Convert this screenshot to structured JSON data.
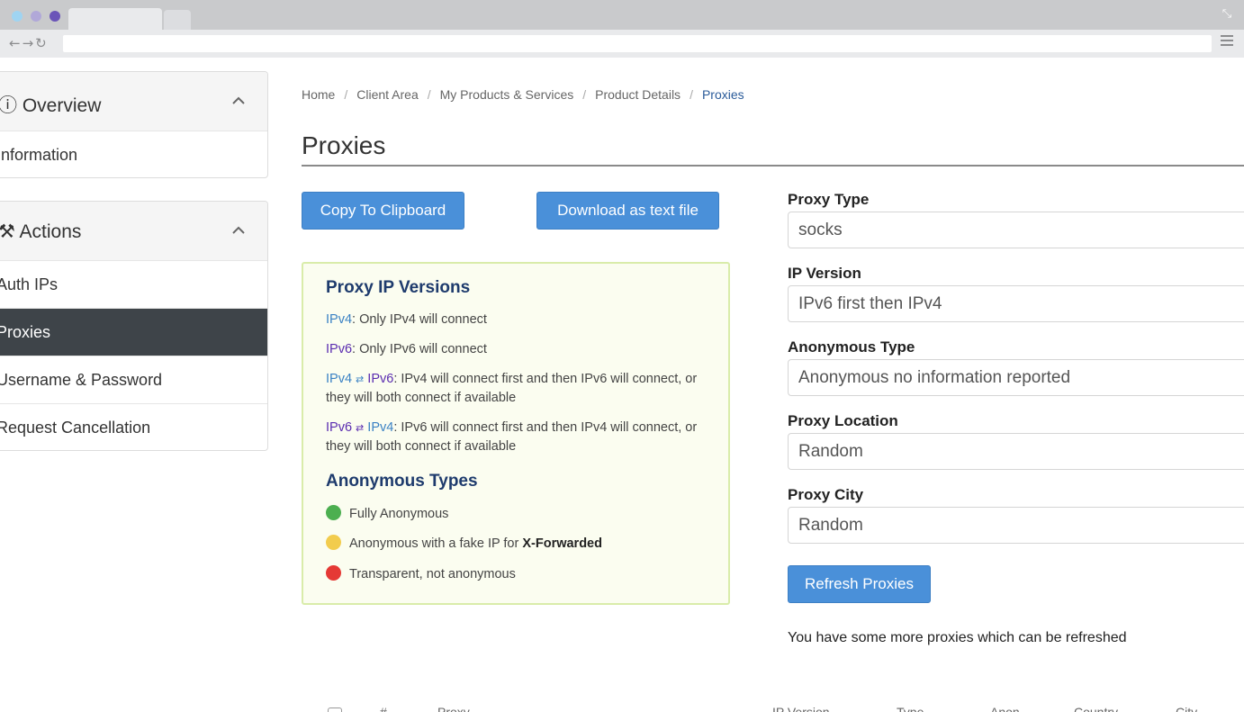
{
  "sidebar": {
    "overview": {
      "title": "Overview",
      "items": [
        "Information"
      ]
    },
    "actions": {
      "title": "Actions",
      "items": [
        "Auth IPs",
        "Proxies",
        "Username & Password",
        "Request Cancellation"
      ],
      "active_index": 1
    }
  },
  "breadcrumb": [
    "Home",
    "Client Area",
    "My Products & Services",
    "Product Details",
    "Proxies"
  ],
  "page_title": "Proxies",
  "buttons": {
    "copy": "Copy To Clipboard",
    "download": "Download as text file",
    "refresh": "Refresh Proxies"
  },
  "info": {
    "versions_title": "Proxy IP Versions",
    "ipv4_label": "IPv4",
    "ipv6_label": "IPv6",
    "v4_desc": ": Only IPv4 will connect",
    "v6_desc": ": Only IPv6 will connect",
    "v4v6_desc": ": IPv4 will connect first and then IPv6 will connect, or they will both connect if available",
    "v6v4_desc": ": IPv6 will connect first and then IPv4 will connect, or they will both connect if available",
    "anon_title": "Anonymous Types",
    "anon_types": [
      {
        "label": "Fully Anonymous",
        "color": "#4caf50"
      },
      {
        "label": "Anonymous with a fake IP for ",
        "bold": "X-Forwarded",
        "color": "#f2cc4d"
      },
      {
        "label": "Transparent, not anonymous",
        "color": "#e53935"
      }
    ]
  },
  "form": {
    "proxy_type": {
      "label": "Proxy Type",
      "value": "socks"
    },
    "ip_version": {
      "label": "IP Version",
      "value": "IPv6 first then IPv4"
    },
    "anonymous_type": {
      "label": "Anonymous Type",
      "value": "Anonymous no information reported"
    },
    "proxy_location": {
      "label": "Proxy Location",
      "value": "Random"
    },
    "proxy_city": {
      "label": "Proxy City",
      "value": "Random"
    }
  },
  "refresh_note": "You have some more proxies which can be refreshed",
  "table_headers": [
    "#",
    "Proxy",
    "IP Version",
    "Type",
    "Anon",
    "Country",
    "City"
  ],
  "colors": {
    "primary_button": "#4a90d9",
    "active_nav": "#3e4449",
    "ipv4": "#3b82c4",
    "ipv6": "#5b2db0",
    "heading": "#1e3b6d"
  }
}
